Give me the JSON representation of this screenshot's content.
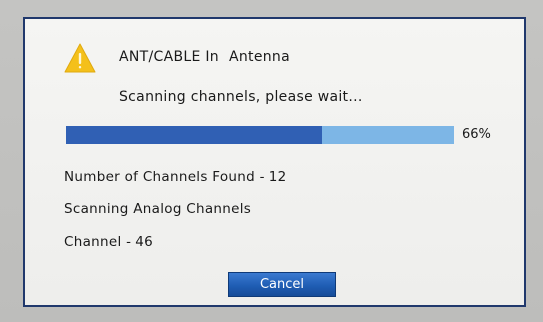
{
  "dialog": {
    "source_label": "ANT/CABLE In",
    "source_value": "Antenna",
    "status_message": "Scanning channels, please wait...",
    "progress": {
      "percent": 66,
      "label": "66%"
    },
    "channels_found_label": "Number of Channels Found -",
    "channels_found_value": "12",
    "scan_mode": "Scanning Analog Channels",
    "channel_label": "Channel -",
    "channel_value": "46",
    "cancel_label": "Cancel"
  },
  "colors": {
    "border": "#20386c",
    "progress_fill": "#3060b4",
    "progress_track": "#7db6e6",
    "warning_icon": "#f4c01a",
    "button": "#1f5db4"
  },
  "icons": {
    "warning": "warning-triangle-icon"
  }
}
